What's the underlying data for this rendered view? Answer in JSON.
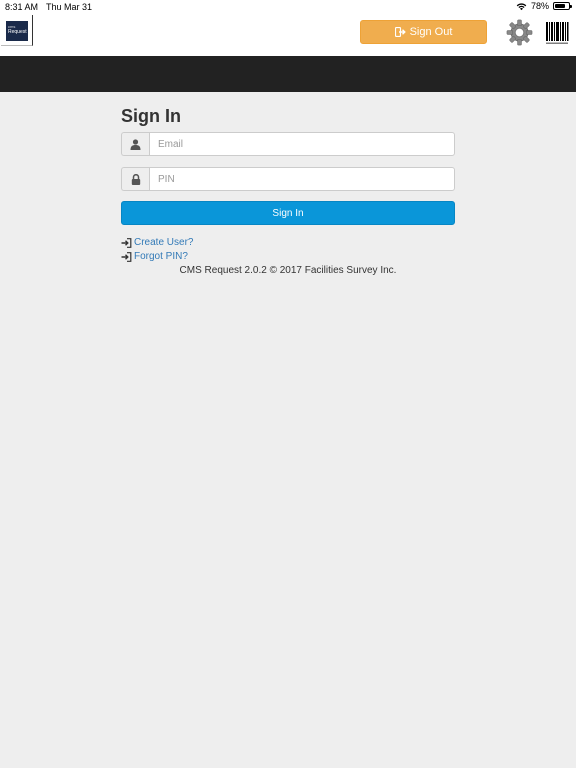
{
  "status_bar": {
    "time": "8:31 AM",
    "date": "Thu Mar 31",
    "battery_percent": "78%",
    "battery_level": 0.78
  },
  "header": {
    "logo_small": "cms",
    "logo_text": "Request",
    "signout_label": "Sign Out",
    "signout_color": "#f0ad4e"
  },
  "form": {
    "title": "Sign In",
    "email_placeholder": "Email",
    "pin_placeholder": "PIN",
    "signin_label": "Sign In",
    "signin_color": "#0a96d9"
  },
  "links": {
    "create_user": "Create User?",
    "forgot_pin": "Forgot PIN?"
  },
  "footer": {
    "text": "CMS Request 2.0.2 © 2017 Facilities Survey Inc."
  },
  "icons": {
    "email_addon": "user-icon",
    "pin_addon": "lock-icon",
    "signout": "sign-out-icon",
    "settings": "gear-icon",
    "scan": "barcode-icon",
    "link": "sign-in-icon"
  }
}
